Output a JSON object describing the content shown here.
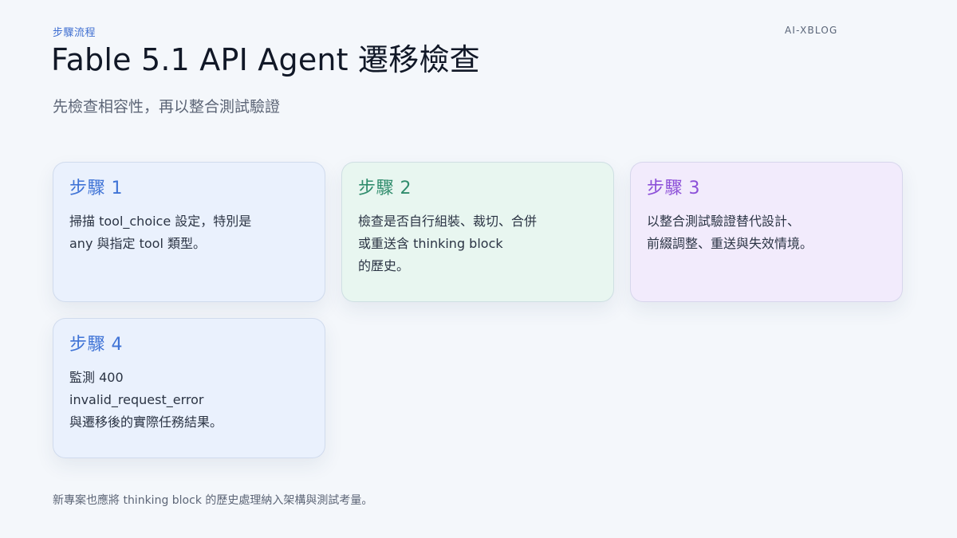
{
  "header": {
    "eyebrow": "步驟流程",
    "brand": "AI-XBLOG",
    "title": "Fable 5.1 API Agent 遷移檢查",
    "subtitle": "先檢查相容性，再以整合測試驗證"
  },
  "cards": [
    {
      "title": "步驟 1",
      "lines": [
        "掃描 tool_choice 設定，特別是",
        "any 與指定 tool 類型。"
      ]
    },
    {
      "title": "步驟 2",
      "lines": [
        "檢查是否自行組裝、裁切、合併",
        "或重送含 thinking block",
        "的歷史。"
      ]
    },
    {
      "title": "步驟 3",
      "lines": [
        "以整合測試驗證替代設計、",
        "前綴調整、重送與失效情境。"
      ]
    },
    {
      "title": "步驟 4",
      "lines": [
        "監測 400",
        "invalid_request_error",
        "與遷移後的實際任務結果。"
      ]
    }
  ],
  "footer": "新專案也應將 thinking block 的歷史處理納入架構與測試考量。",
  "colors": {
    "accent_blue": "#3f73d6",
    "accent_green": "#2f8c6c",
    "accent_purple": "#8c4fd8",
    "card_blue_bg": "#eaf1fd",
    "card_green_bg": "#e8f6f0",
    "card_purple_bg": "#f2ebfc"
  }
}
